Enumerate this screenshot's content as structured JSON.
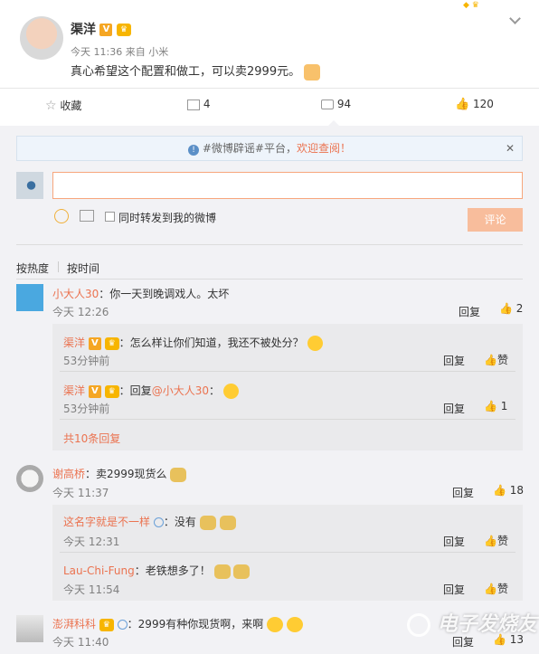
{
  "post": {
    "author": "渠洋",
    "time": "今天 11:36 来自 小米",
    "text": "真心希望这个配置和做工，可以卖2999元。"
  },
  "toolbar": {
    "favorite_label": "收藏",
    "repost_count": "4",
    "comment_count": "94",
    "like_count": "120"
  },
  "notice": {
    "text_prefix": "#微博辟谣#平台，",
    "text_link": "欢迎查阅！"
  },
  "composer": {
    "repost_checkbox_label": "同时转发到我的微博",
    "submit_label": "评论"
  },
  "sort": {
    "hot": "按热度",
    "time": "按时间"
  },
  "comments": [
    {
      "author": "小大人30",
      "text": "：你一天到晚调戏人。太坏",
      "time": "今天 12:26",
      "reply_label": "回复",
      "like_count": "2",
      "replies": [
        {
          "author": "渠洋",
          "text": "：怎么样让你们知道，我还不被处分？",
          "time": "53分钟前",
          "reply_label": "回复",
          "like_label": "赞"
        },
        {
          "author": "渠洋",
          "text_prefix": "：回复",
          "mention": "@小大人30",
          "text": "：",
          "time": "53分钟前",
          "reply_label": "回复",
          "like_count": "1"
        }
      ],
      "more_label": "共10条回复"
    },
    {
      "author": "谢高桥",
      "text": "：卖2999现货么",
      "time": "今天 11:37",
      "reply_label": "回复",
      "like_count": "18",
      "replies": [
        {
          "author": "这名字就是不一样",
          "text": "：没有",
          "time": "今天 12:31",
          "reply_label": "回复",
          "like_label": "赞"
        },
        {
          "author": "Lau-Chi-Fung",
          "text": "：老铁想多了！",
          "time": "今天 11:54",
          "reply_label": "回复",
          "like_label": "赞"
        }
      ]
    },
    {
      "author": "澎湃科科",
      "text": "：2999有种你现货啊，来啊",
      "time": "今天 11:40",
      "reply_label": "回复",
      "like_count": "13"
    }
  ],
  "watermark": "电子发烧友"
}
